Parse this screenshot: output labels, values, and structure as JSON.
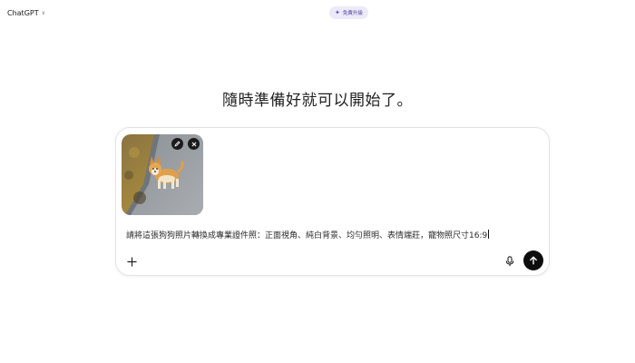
{
  "header": {
    "model_name": "ChatGPT",
    "upgrade_label": "免費升級"
  },
  "headline": "隨時準備好就可以開始了。",
  "composer": {
    "prompt_text": "請將這張狗狗照片轉換成專業證件照：正面視角、純白背景、均勻照明、表情端莊，寵物照尺寸16:9",
    "attachment": {
      "kind": "image",
      "subject": "corgi dog on pavement"
    }
  },
  "icons": {
    "model_chevron": "chevron-down-icon",
    "upgrade": "sparkle-icon",
    "edit": "pencil-icon",
    "remove": "close-icon",
    "add": "plus-icon",
    "mic": "microphone-icon",
    "send": "arrow-up-icon"
  },
  "colors": {
    "send_button": "#0d0d0d",
    "upgrade_bg": "#eceaf8",
    "upgrade_text": "#4b3f9e"
  }
}
